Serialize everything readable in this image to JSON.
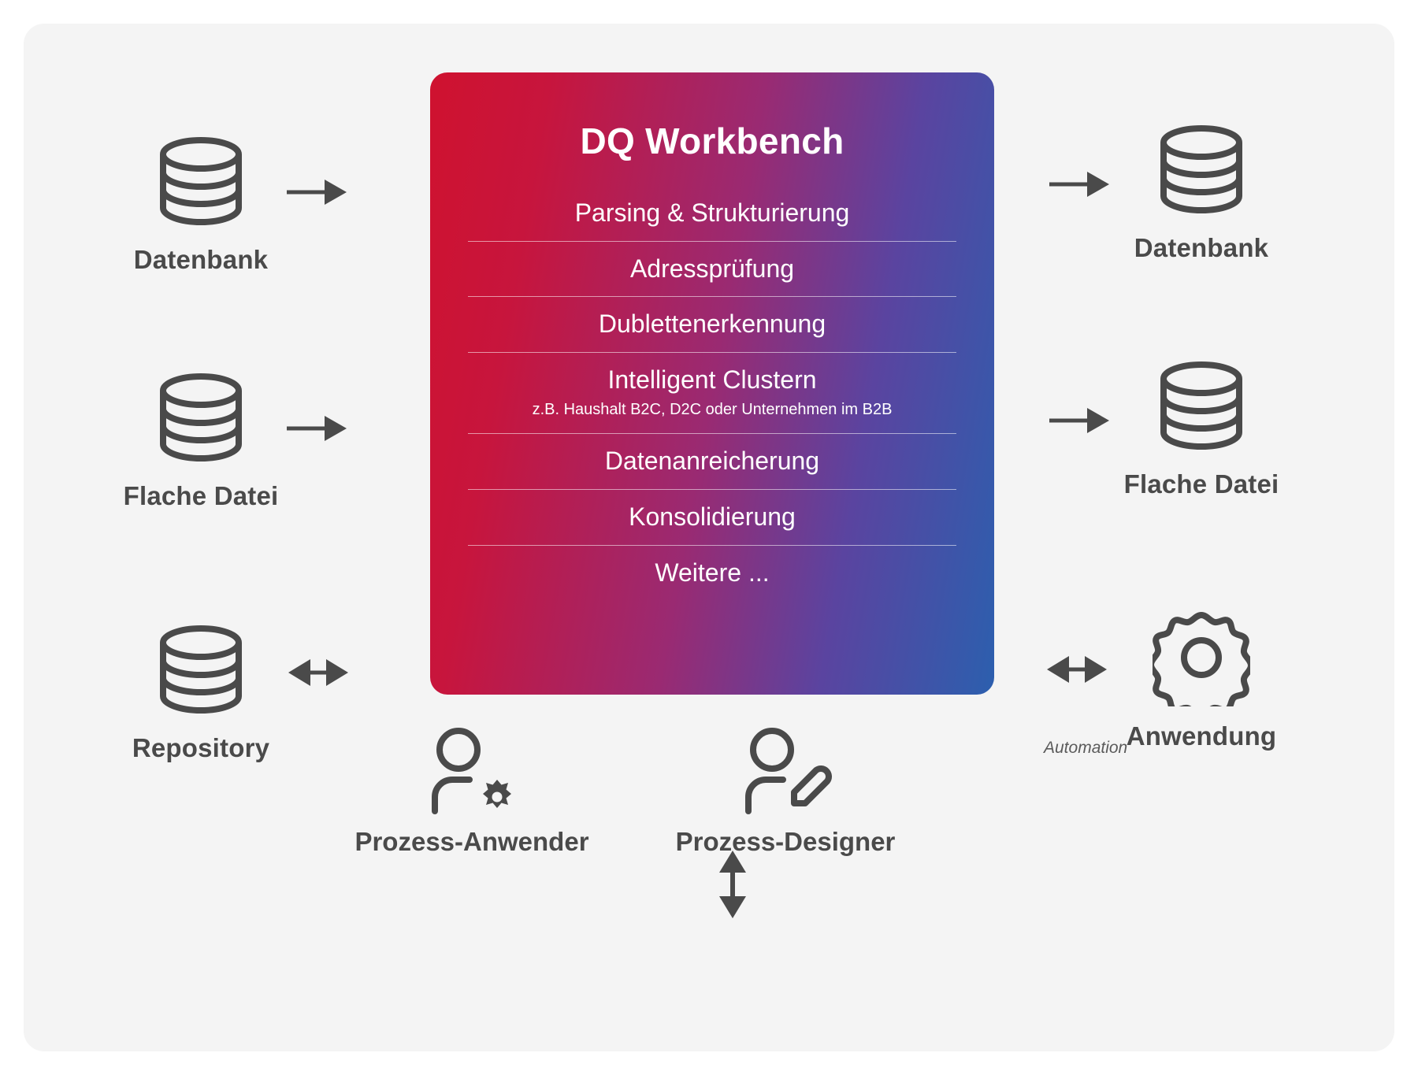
{
  "card": {
    "title": "DQ Workbench",
    "gradient_from": "#cf122f",
    "gradient_to": "#2c5fae",
    "items": [
      {
        "label": "Parsing & Strukturierung",
        "sub": ""
      },
      {
        "label": "Adressprüfung",
        "sub": ""
      },
      {
        "label": "Dublettenerkennung",
        "sub": ""
      },
      {
        "label": "Intelligent Clustern",
        "sub": "z.B. Haushalt B2C, D2C oder Unternehmen im B2B"
      },
      {
        "label": "Datenanreicherung",
        "sub": ""
      },
      {
        "label": "Konsolidierung",
        "sub": ""
      },
      {
        "label": "Weitere ...",
        "sub": ""
      }
    ]
  },
  "inputs": [
    {
      "label": "Datenbank",
      "icon": "database-icon",
      "arrow": "arrow-right-icon"
    },
    {
      "label": "Flache Datei",
      "icon": "database-icon",
      "arrow": "arrow-right-icon"
    },
    {
      "label": "Repository",
      "icon": "database-icon",
      "arrow": "arrow-left-right-icon"
    }
  ],
  "outputs": [
    {
      "label": "Datenbank",
      "icon": "database-icon",
      "arrow": "arrow-right-icon"
    },
    {
      "label": "Flache Datei",
      "icon": "database-icon",
      "arrow": "arrow-right-icon"
    },
    {
      "label": "Anwendung",
      "icon": "gear-icon",
      "arrow": "arrow-left-right-icon",
      "annotation": "Automation"
    }
  ],
  "personas": [
    {
      "label": "Prozess-Anwender",
      "icon": "person-gear-icon"
    },
    {
      "label": "Prozess-Designer",
      "icon": "person-pencil-icon"
    }
  ],
  "connector": {
    "icon": "arrow-up-down-icon"
  },
  "colors": {
    "stroke": "#4a4a4a",
    "panel_bg": "#f4f4f4",
    "text": "#4a4a4a"
  }
}
